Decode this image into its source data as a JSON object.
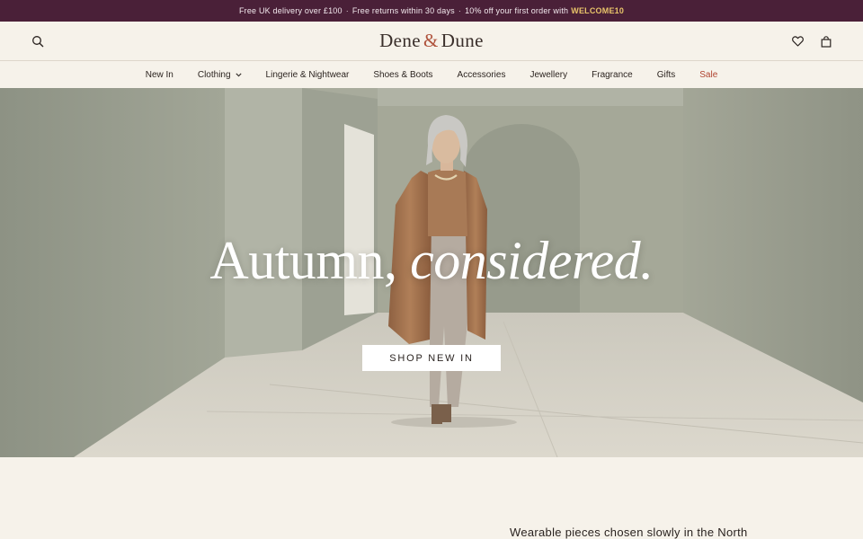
{
  "promo": {
    "delivery": "Free UK delivery over £100",
    "returns": "Free returns within 30 days",
    "offer": "10% off your first order with",
    "code": "WELCOME10",
    "sep": "·"
  },
  "header": {
    "logo_left": "Dene",
    "logo_amp": "&",
    "logo_right": "Dune",
    "icons": [
      "search-icon",
      "heart-icon",
      "bag-icon"
    ]
  },
  "nav": {
    "items": [
      {
        "label": "New In"
      },
      {
        "label": "Clothing"
      },
      {
        "label": "Lingerie & Nightwear"
      },
      {
        "label": "Shoes & Boots"
      },
      {
        "label": "Accessories"
      },
      {
        "label": "Jewellery"
      },
      {
        "label": "Fragrance"
      },
      {
        "label": "Gifts"
      },
      {
        "label": "Sale"
      }
    ]
  },
  "hero": {
    "title_plain": "Autumn,",
    "title_italic": "considered.",
    "cta": "SHOP NEW IN"
  },
  "intro": {
    "text": "Wearable pieces chosen slowly in the North"
  },
  "colors": {
    "promo_bg": "#4a2038",
    "code": "#e8c46a",
    "accent": "#b0543e",
    "sale": "#b0432f",
    "page_bg": "#f6f2ea"
  }
}
